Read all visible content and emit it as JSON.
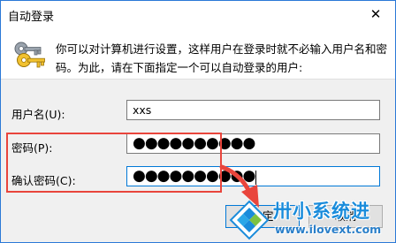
{
  "window": {
    "title": "自动登录",
    "close_glyph": "✕"
  },
  "description": "你可以对计算机进行设置，这样用户在登录时就不必输入用户名和密码。为此，请在下面指定一个可以自动登录的用户:",
  "form": {
    "username": {
      "label": "用户名(U):",
      "value": "xxs"
    },
    "password": {
      "label": "密码(P):",
      "value": "●●●●●●●●●●"
    },
    "confirm_password": {
      "label": "确认密码(C):",
      "value": "●●●●●●●●●●"
    }
  },
  "buttons": {
    "ok_label": "确定",
    "cancel_label": "取消"
  },
  "watermark": {
    "name": "卅小系统进",
    "url": "www.ilovext.com"
  },
  "colors": {
    "accent": "#0078d7",
    "highlight_red": "#e9453c",
    "watermark_blue": "#1a8cdb"
  },
  "icons": {
    "keys": "keys-icon",
    "close": "close-icon",
    "arrow": "red-arrow-icon",
    "logo": "watermark-logo-icon"
  }
}
